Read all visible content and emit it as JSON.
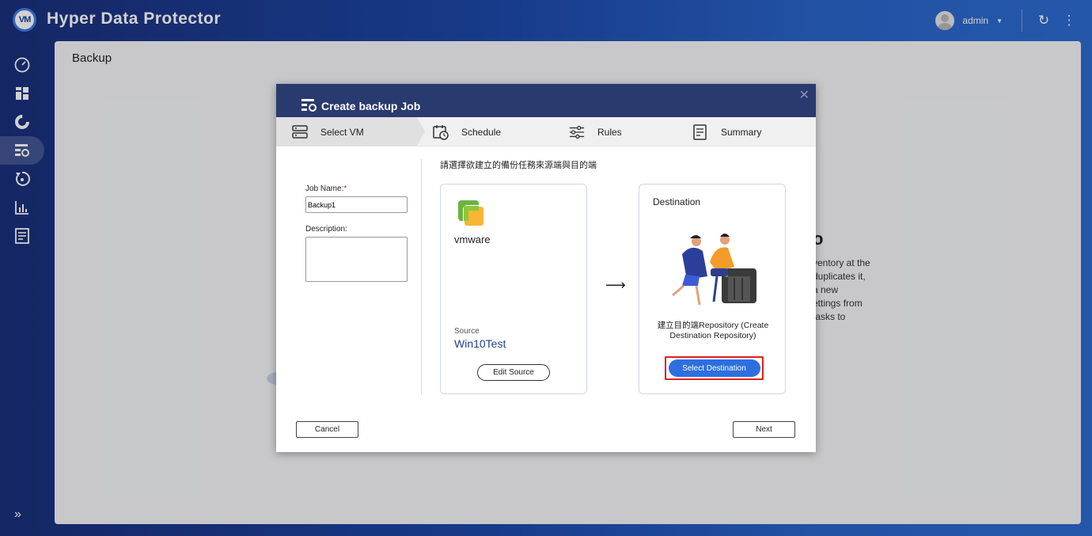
{
  "app": {
    "logo_text": "VM",
    "title": "Hyper Data Protector"
  },
  "header": {
    "user": "admin"
  },
  "page": {
    "title": "Backup",
    "bg_heading_fragment": "o",
    "bg_text_lines": [
      "ventory at the",
      "duplicates it,",
      "a new",
      "ettings from",
      "tasks to"
    ]
  },
  "dialog": {
    "title": "Create backup Job",
    "steps": [
      {
        "label": "Select VM"
      },
      {
        "label": "Schedule"
      },
      {
        "label": "Rules"
      },
      {
        "label": "Summary"
      }
    ],
    "job_name_label": "Job Name:",
    "job_name_required": "*",
    "job_name_value": "Backup1",
    "description_label": "Description:",
    "instruction": "請選擇欲建立的備份任務來源端與目的端",
    "source_card": {
      "vendor": "vmware",
      "source_label": "Source",
      "source_value": "Win10Test",
      "edit_button": "Edit Source"
    },
    "destination_card": {
      "title": "Destination",
      "description": "建立目的端Repository (Create Destination Repository)",
      "select_button": "Select Destination"
    },
    "cancel_button": "Cancel",
    "next_button": "Next"
  },
  "colors": {
    "header_bg": "#293a6e",
    "primary_button": "#2d6fe0",
    "highlight_border": "#e0201a"
  }
}
